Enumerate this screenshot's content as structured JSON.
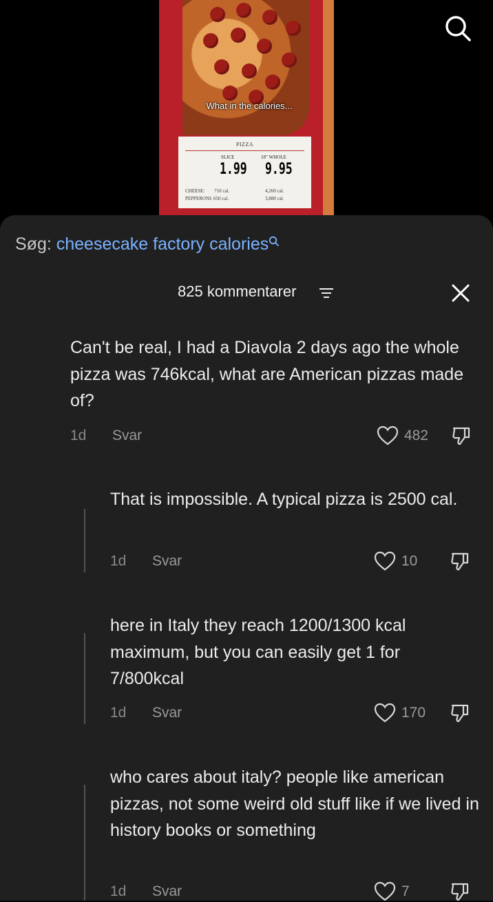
{
  "video": {
    "overlay_caption": "What in the calories...",
    "menu": {
      "title": "PIZZA",
      "slice_label": "SLICE",
      "whole_label": "18\" WHOLE",
      "slice_price": "1.99",
      "whole_price": "9.95",
      "row1_label": "CHEESE:",
      "row1_slice_cal": "710 cal.",
      "row1_whole_cal": "4,260 cal.",
      "row2_label": "PEPPERONI:",
      "row2_slice_cal": "650 cal.",
      "row2_whole_cal": "3,880 cal."
    }
  },
  "search": {
    "prefix": "Søg:",
    "query": "cheesecake factory calories"
  },
  "header": {
    "comment_count": "825 kommentarer"
  },
  "comments": [
    {
      "text": "Can't be real, I had a Diavola 2 days ago the whole pizza was 746kcal, what are American pizzas made of?",
      "age": "1d",
      "reply_label": "Svar",
      "likes": "482"
    },
    {
      "text": "That is impossible. A typical pizza is 2500 cal.",
      "age": "1d",
      "reply_label": "Svar",
      "likes": "10"
    },
    {
      "text": "here in Italy they reach 1200/1300 kcal maximum, but you can easily get 1 for 7/800kcal",
      "age": "1d",
      "reply_label": "Svar",
      "likes": "170"
    },
    {
      "text": "who cares about italy? people like american pizzas, not some weird old stuff like if we lived in history books or something",
      "age": "1d",
      "reply_label": "Svar",
      "likes": "7"
    }
  ],
  "colors": {
    "panel": "#202020",
    "link": "#7ab2ff",
    "muted": "#8a8a8a"
  }
}
